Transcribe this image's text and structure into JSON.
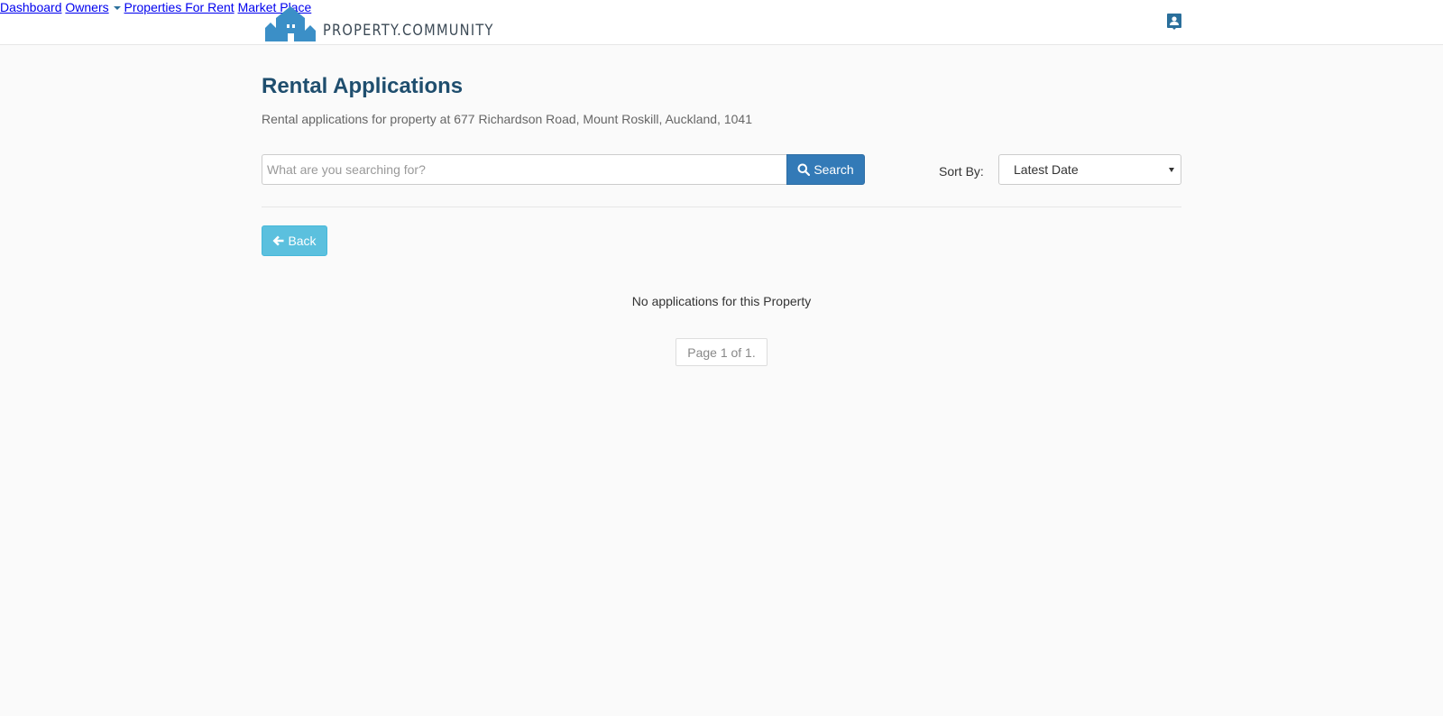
{
  "header": {
    "brand": "PROPERTY.COMMUNITY",
    "brand_color": "#3b8fc7",
    "nav": {
      "dashboard": "Dashboard",
      "owners": "Owners",
      "properties_for_rent": "Properties For Rent",
      "market_place": "Market Place"
    },
    "icons": {
      "owners_dropdown": "caret-down-icon",
      "profile": "user-profile-icon"
    }
  },
  "main": {
    "title": "Rental Applications",
    "subtitle": "Rental applications for property at 677 Richardson Road, Mount Roskill, Auckland, 1041",
    "search": {
      "placeholder": "What are you searching for?",
      "value": "",
      "button_label": "Search",
      "button_icon": "search-icon"
    },
    "sort": {
      "label": "Sort By:",
      "selected": "Latest Date"
    },
    "back": {
      "label": "Back",
      "icon": "arrow-left-icon"
    },
    "empty_message": "No applications for this Property",
    "pagination": "Page 1 of 1."
  },
  "colors": {
    "link": "#2a6f9b",
    "title": "#1f4e6e",
    "primary_button": "#337ab7",
    "info_button": "#5bc0de",
    "background": "#fafafa"
  }
}
